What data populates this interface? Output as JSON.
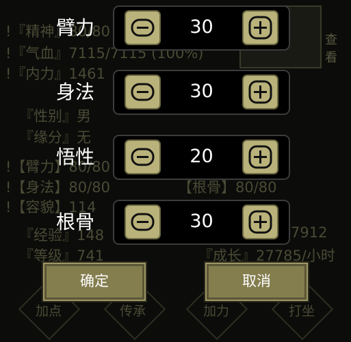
{
  "background": {
    "lines": [
      "!『精神』80/80",
      "!『气血』7115/7115 (100%)",
      "!『内力』1461",
      "『性别』男",
      "『缘分』无",
      "!【臂力】80/80",
      "!【身法】80/80",
      "!【容貌】114",
      "『经验』148",
      "『等级』741",
      "『成长』27785/小时",
      "【根骨】80/80",
      "7912"
    ],
    "look_label": "查看",
    "bottom_tabs": [
      "加点",
      "传承",
      "加力",
      "打坐"
    ]
  },
  "stats": [
    {
      "label": "臂力",
      "value": "30"
    },
    {
      "label": "身法",
      "value": "30"
    },
    {
      "label": "悟性",
      "value": "20"
    },
    {
      "label": "根骨",
      "value": "30"
    }
  ],
  "buttons": {
    "confirm": "确定",
    "cancel": "取消"
  },
  "colors": {
    "step_button": "#b9b27a",
    "action_button": "#847d4e",
    "background_text": "#4a4a36"
  }
}
